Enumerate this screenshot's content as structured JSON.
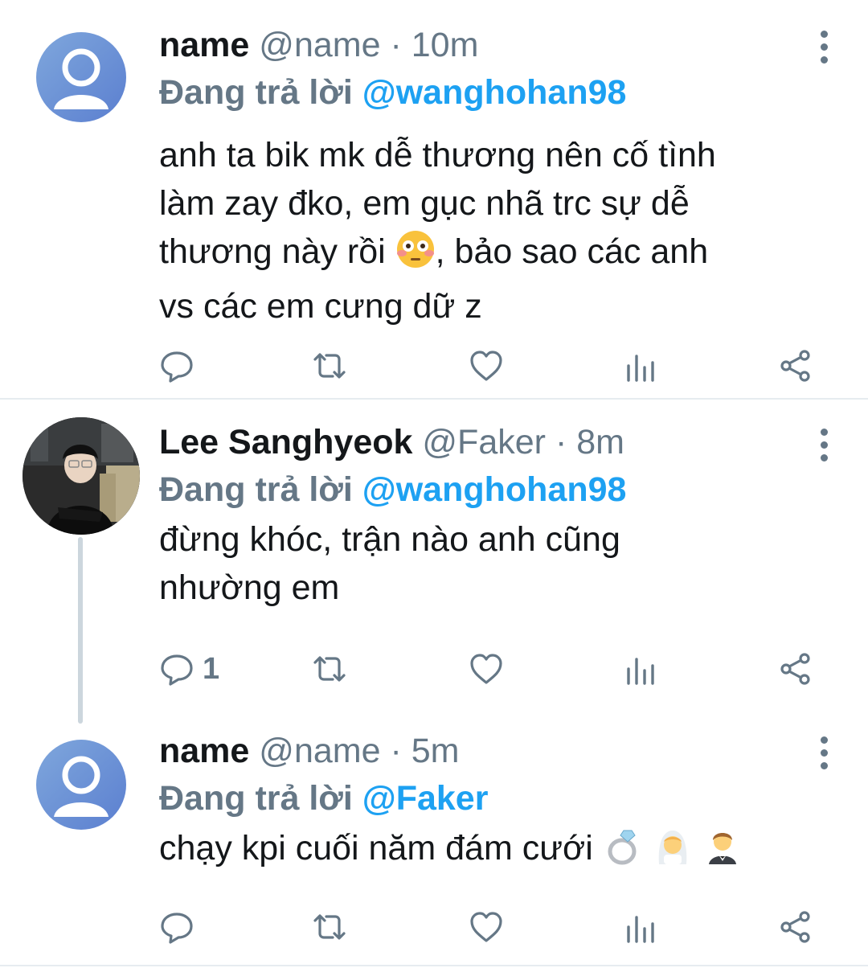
{
  "tweets": [
    {
      "display_name": "name",
      "handle": "@name",
      "separator": "·",
      "time": "10m",
      "reply_prefix": "Đang trả lời",
      "reply_to": "@wanghohan98",
      "text_lines": [
        "anh ta bik mk dễ thương nên cố tình",
        "làm zay đko, em gục nhã trc sự dễ",
        "thương này rồi",
        ", bảo sao các anh",
        "vs các em cưng dữ z"
      ],
      "reply_count": "",
      "avatar": "default-avatar"
    },
    {
      "display_name": "Lee Sanghyeok",
      "handle": "@Faker",
      "separator": "·",
      "time": "8m",
      "reply_prefix": "Đang trả lời",
      "reply_to": "@wanghohan98",
      "text_lines": [
        "đừng khóc, trận nào anh cũng",
        "nhường em"
      ],
      "reply_count": "1",
      "avatar": "photo-avatar"
    },
    {
      "display_name": "name",
      "handle": "@name",
      "separator": "·",
      "time": "5m",
      "reply_prefix": "Đang trả lời",
      "reply_to": "@Faker",
      "text_lines": [
        "chạy kpi cuối năm đám cưới"
      ],
      "reply_count": "",
      "avatar": "default-avatar"
    }
  ],
  "icons": {
    "reply": "reply-icon",
    "retweet": "retweet-icon",
    "like": "heart-icon",
    "analytics": "analytics-icon",
    "share": "share-icon",
    "more": "more-vertical-icon",
    "emojis": [
      "flushed-face-emoji",
      "ring-emoji",
      "bride-emoji",
      "groom-emoji"
    ]
  },
  "colors": {
    "text": "#14171a",
    "secondary": "#657786",
    "mention": "#1da1f2",
    "divider": "#e6ecf0",
    "thread_line": "#ccd6dd"
  }
}
